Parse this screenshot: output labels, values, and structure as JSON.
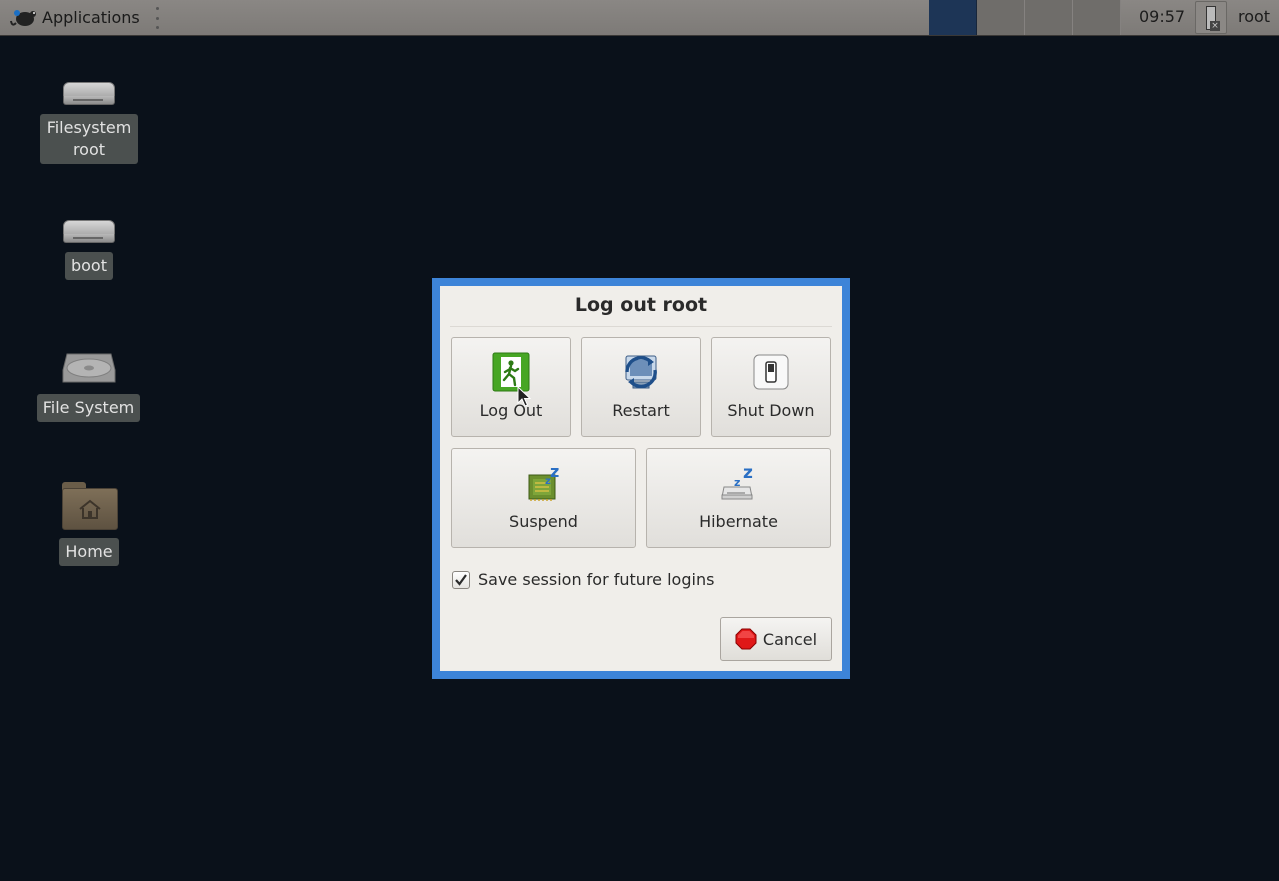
{
  "panel": {
    "app_menu_label": "Applications",
    "clock": "09:57",
    "user": "root",
    "workspaces": [
      "1",
      "2",
      "3",
      "4"
    ],
    "active_workspace": 0,
    "active_workspace_color": "#1d3556"
  },
  "desktop": {
    "icons": [
      {
        "label": "Filesystem root",
        "icon": "drive-icon"
      },
      {
        "label": "boot",
        "icon": "drive-icon"
      },
      {
        "label": "File System",
        "icon": "harddisk-icon"
      },
      {
        "label": "Home",
        "icon": "home-folder-icon"
      }
    ]
  },
  "dialog": {
    "title": "Log out root",
    "frame_color": "#3d84d8",
    "actions": [
      {
        "label": "Log Out",
        "icon": "exit-icon"
      },
      {
        "label": "Restart",
        "icon": "restart-icon"
      },
      {
        "label": "Shut Down",
        "icon": "power-switch-icon"
      },
      {
        "label": "Suspend",
        "icon": "suspend-icon"
      },
      {
        "label": "Hibernate",
        "icon": "hibernate-icon"
      }
    ],
    "save_session": {
      "label": "Save session for future logins",
      "checked": true
    },
    "cancel_label": "Cancel"
  }
}
